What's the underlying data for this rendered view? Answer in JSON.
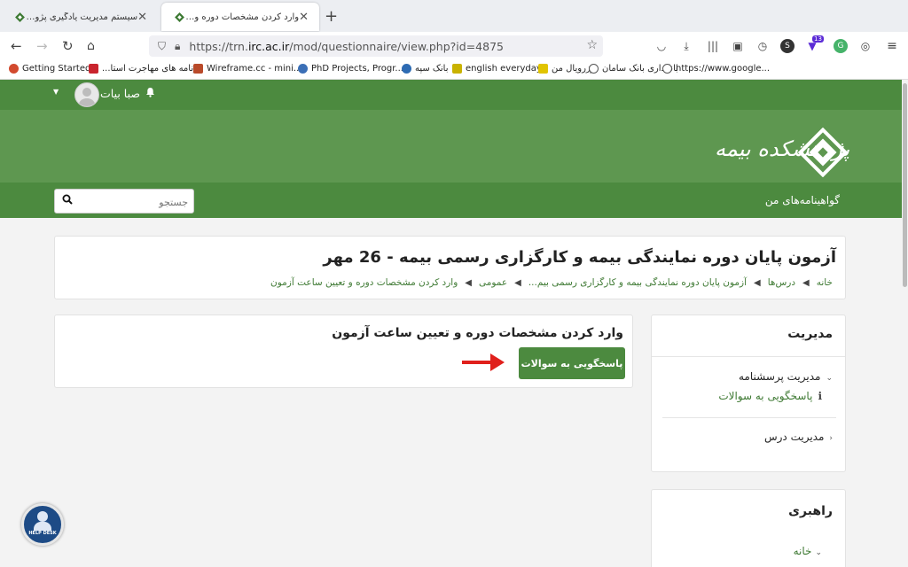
{
  "browser": {
    "tabs": [
      {
        "title": "سیستم مدیریت یادگیری پژوهشکده بیمه",
        "active": false
      },
      {
        "title": "وارد کردن مشخصات دوره و تعیین ساعت",
        "active": true
      }
    ],
    "url_prefix": "https://trn.",
    "url_domain": "irc.ac.ir",
    "url_path": "/mod/questionnaire/view.php?id=4875",
    "toolbar_badge": "13",
    "bookmarks": [
      {
        "label": "Getting Started",
        "color": "#d24a2e"
      },
      {
        "label": "برنامه های مهاجرت استا...",
        "color": "#c9242d"
      },
      {
        "label": "Wireframe.cc - mini...",
        "color": "#b94a2a"
      },
      {
        "label": "PhD Projects, Progr...",
        "color": "#3b6fb6"
      },
      {
        "label": "بانک سپه",
        "color": "#2d6bb3"
      },
      {
        "label": "english everyday",
        "color": "#c9b200"
      },
      {
        "label": "رزرویال من",
        "color": "#e1c400"
      },
      {
        "label": "بانکداری بانک سامان",
        "color": "#555555"
      },
      {
        "label": "https://www.google...",
        "color": "#555555"
      }
    ]
  },
  "site": {
    "user_name": "صبا بیات",
    "logo_text": "پژوهشکده بیمه",
    "search_placeholder": "جستجو",
    "nav_mycerts": "گواهینامه‌های من",
    "accent": "#4c8a3f"
  },
  "course": {
    "title": "آزمون پایان دوره نمایندگی بیمه و کارگزاری رسمی بیمه - 26 مهر",
    "breadcrumbs": [
      "خانه",
      "درس‌ها",
      "آزمون پایان دوره نمایندگی بیمه و کارگزاری رسمی بیم...",
      "عمومی",
      "وارد کردن مشخصات دوره و تعیین ساعت آزمون"
    ]
  },
  "main": {
    "heading": "وارد کردن مشخصات دوره و تعیین ساعت آزمون",
    "answer_button": "پاسخگویی به سوالات"
  },
  "sidebar": {
    "admin_title": "مدیریت",
    "questionnaire_admin": "مدیریت پرسشنامه",
    "answer_link": "پاسخگویی به سوالات",
    "course_admin": "مدیریت درس",
    "nav_title": "راهبری",
    "nav_home": "خانه"
  },
  "helpdesk": {
    "label": "HELP DESK"
  }
}
